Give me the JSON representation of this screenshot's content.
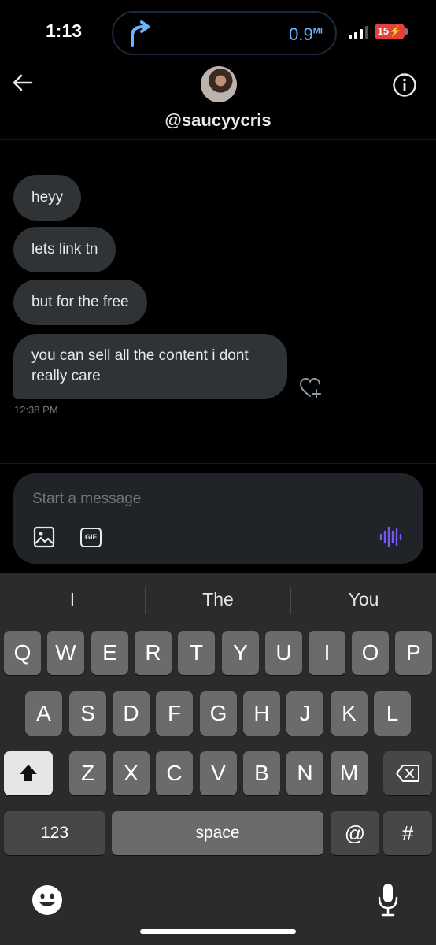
{
  "status_bar": {
    "time": "1:13",
    "nav_distance": "0.9",
    "nav_unit": "MI",
    "battery": "15"
  },
  "header": {
    "username": "@saucyycris"
  },
  "messages": [
    {
      "text": "heyy"
    },
    {
      "text": "lets link tn"
    },
    {
      "text": "but for the free"
    },
    {
      "text": "you can sell all the content i dont really care"
    }
  ],
  "timestamp": "12:38 PM",
  "composer": {
    "placeholder": "Start a message",
    "gif_label": "GIF"
  },
  "keyboard": {
    "suggestions": [
      "I",
      "The",
      "You"
    ],
    "row1": [
      "Q",
      "W",
      "E",
      "R",
      "T",
      "Y",
      "U",
      "I",
      "O",
      "P"
    ],
    "row2": [
      "A",
      "S",
      "D",
      "F",
      "G",
      "H",
      "J",
      "K",
      "L"
    ],
    "row3": [
      "Z",
      "X",
      "C",
      "V",
      "B",
      "N",
      "M"
    ],
    "numbers_label": "123",
    "space_label": "space",
    "at_label": "@",
    "hash_label": "#"
  },
  "colors": {
    "bubble": "#2f3336",
    "accent_voice": "#7856ff",
    "nav_blue": "#6ab4ff"
  }
}
